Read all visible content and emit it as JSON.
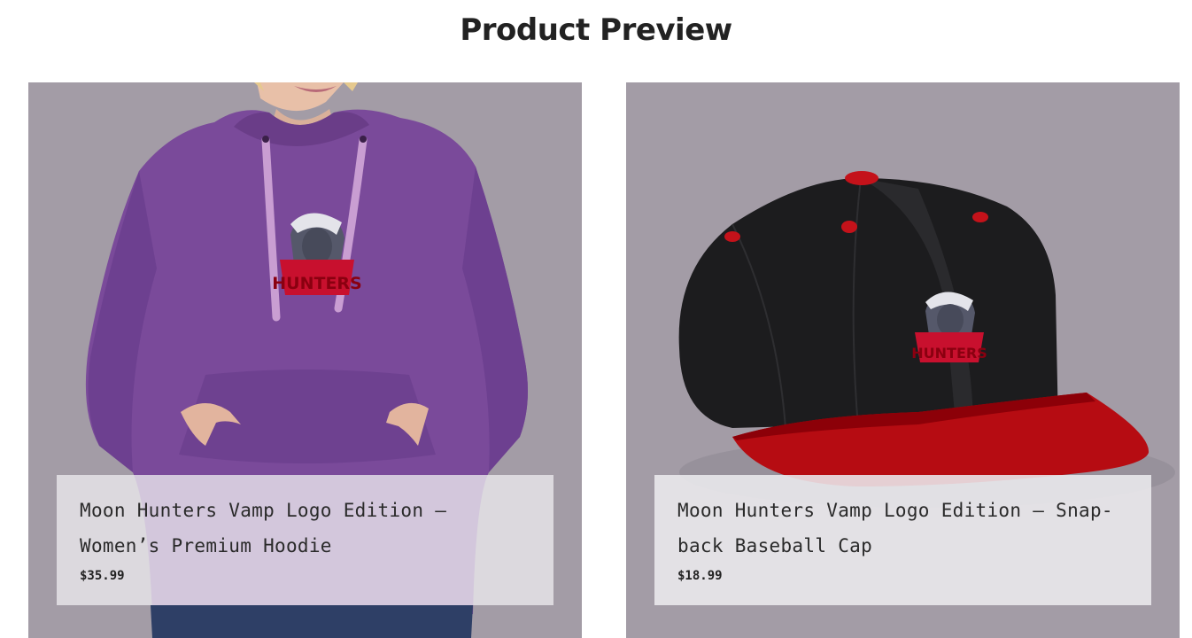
{
  "header": {
    "title": "Product Preview"
  },
  "products": [
    {
      "name": "Moon Hunters Vamp Logo Edition – Women’s Premium Hoodie",
      "price": "$35.99",
      "image": "purple-hoodie-image",
      "logo_text": "HUNTERS"
    },
    {
      "name": "Moon Hunters Vamp Logo Edition – Snap-back Baseball Cap",
      "price": "$18.99",
      "image": "black-red-snapback-cap-image",
      "logo_text": "HUNTERS"
    }
  ],
  "colors": {
    "card_background": "#a39ca6",
    "hoodie": "#7a4a9a",
    "cap_crown": "#1c1c1e",
    "cap_brim": "#b60c12",
    "logo_red": "#c8102e"
  }
}
